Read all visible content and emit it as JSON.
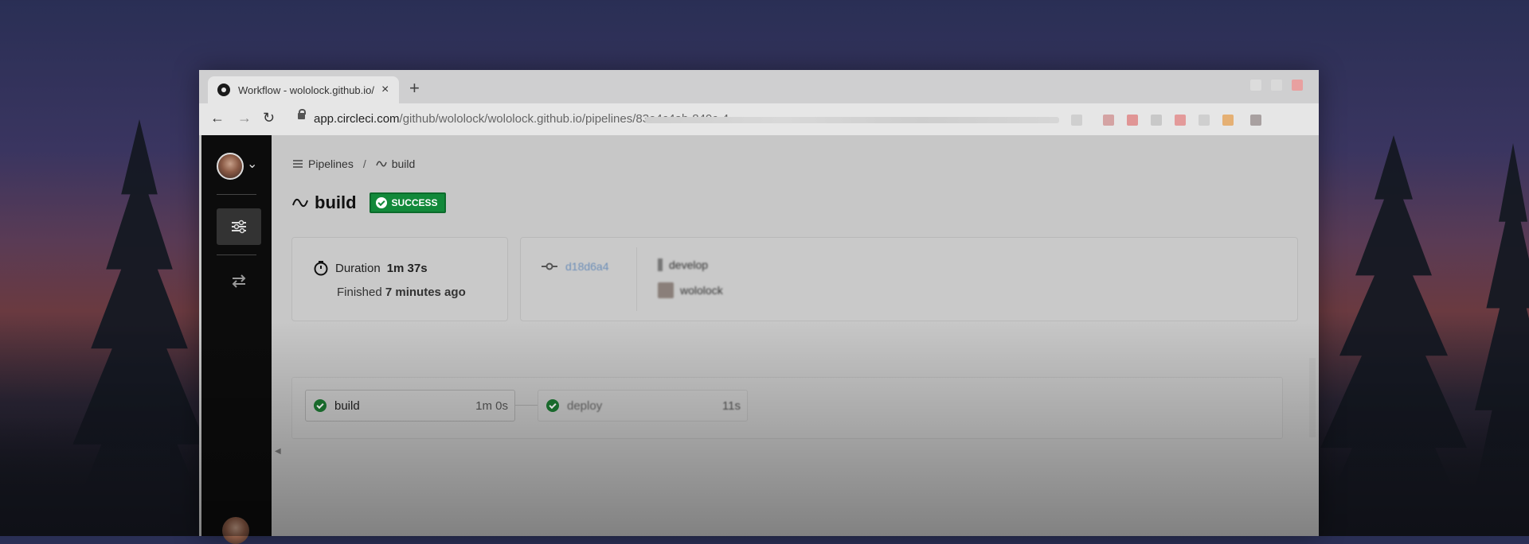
{
  "browser": {
    "tab_title": "Workflow - wololock.github.io/",
    "tab_close": "×",
    "new_tab": "+",
    "url_host": "app.circleci.com",
    "url_path": "/github/wololock/wololock.github.io/pipelines/83e4c4ab-849c-4"
  },
  "breadcrumb": {
    "pipelines": "Pipelines",
    "separator": "/",
    "current": "build"
  },
  "header": {
    "title": "build",
    "status": "SUCCESS"
  },
  "summary": {
    "duration_label": "Duration",
    "duration_value": "1m 37s",
    "finished_label": "Finished",
    "finished_value": "7 minutes ago"
  },
  "commit": {
    "hash": "d18d6a4",
    "branch": "develop",
    "author": "wololock"
  },
  "jobs": [
    {
      "name": "build",
      "duration": "1m 0s",
      "status": "success"
    },
    {
      "name": "deploy",
      "duration": "11s",
      "status": "success"
    }
  ],
  "colors": {
    "success": "#12893a",
    "sidebar": "#0c0c0c",
    "link": "#6e8fb8"
  },
  "icons": [
    "pipelines-icon",
    "workflow-icon",
    "timer-icon",
    "commit-icon",
    "branch-icon",
    "check-icon",
    "chevron-down-icon",
    "back-icon",
    "forward-icon",
    "reload-icon",
    "lock-icon"
  ]
}
